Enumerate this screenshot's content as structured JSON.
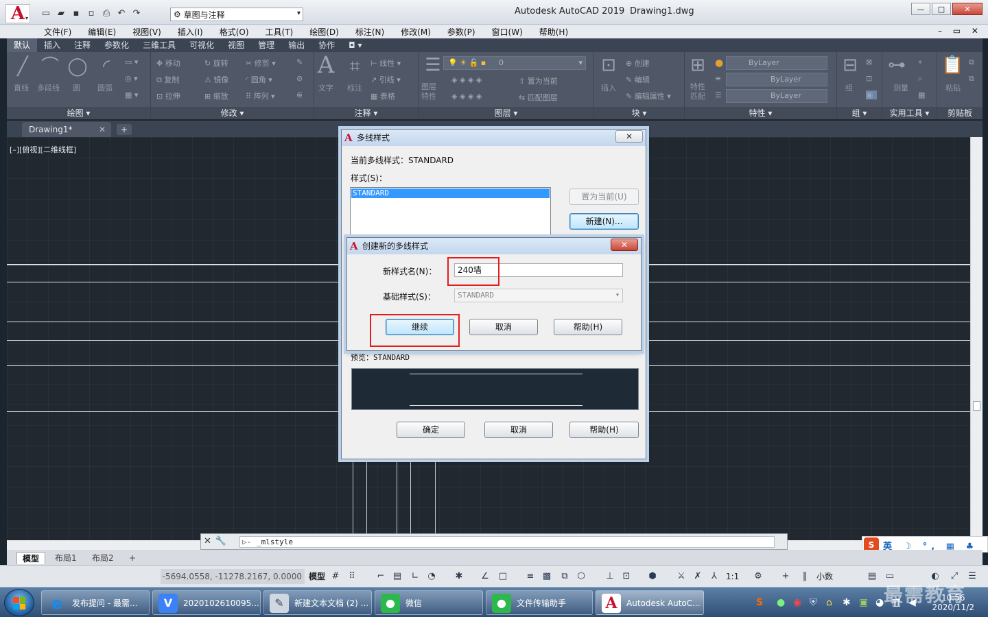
{
  "titlebar": {
    "app_title": "Autodesk AutoCAD 2019",
    "doc_title": "Drawing1.dwg",
    "workspace": "草图与注释",
    "min": "—",
    "max": "□",
    "close": "✕"
  },
  "menubar": {
    "items": [
      "文件(F)",
      "编辑(E)",
      "视图(V)",
      "插入(I)",
      "格式(O)",
      "工具(T)",
      "绘图(D)",
      "标注(N)",
      "修改(M)",
      "参数(P)",
      "窗口(W)",
      "帮助(H)"
    ],
    "mdi_controls": "– ▭ ✕"
  },
  "ribbon": {
    "tabs": [
      "默认",
      "插入",
      "注释",
      "参数化",
      "三维工具",
      "可视化",
      "视图",
      "管理",
      "输出",
      "协作"
    ],
    "tab_extra": "◘ ▾",
    "groups": [
      "绘图 ▾",
      "修改 ▾",
      "注释 ▾",
      "图层 ▾",
      "块 ▾",
      "特性 ▾",
      "组 ▾",
      "实用工具 ▾",
      "剪贴板"
    ],
    "draw_tools": [
      "直线",
      "多段线",
      "圆",
      "圆弧"
    ],
    "modify_tools": [
      "移动",
      "旋转",
      "修剪",
      "复制",
      "镜像",
      "圆角",
      "拉伸",
      "缩放",
      "阵列"
    ],
    "annot_tools": [
      "文字",
      "标注",
      "线性",
      "引线",
      "表格"
    ],
    "layer_tools": [
      "图层特性",
      "置为当前",
      "匹配图层"
    ],
    "layer_current": "0",
    "block_tools": [
      "插入",
      "创建",
      "编辑",
      "编辑属性"
    ],
    "prop_tools": [
      "特性匹配"
    ],
    "prop_values": [
      "ByLayer",
      "ByLayer",
      "ByLayer"
    ],
    "group_tools": [
      "组"
    ],
    "util_tools": [
      "测量"
    ],
    "clip_tools": [
      "粘贴"
    ]
  },
  "doctabs": {
    "active": "Drawing1*",
    "close": "✕",
    "new": "+"
  },
  "canvas": {
    "view_label": "[–][俯视][二维线框]"
  },
  "cmdline": {
    "value": "_mlstyle",
    "prompt": "▷-"
  },
  "layouts": {
    "tabs": [
      "模型",
      "布局1",
      "布局2"
    ],
    "add": "+"
  },
  "statusbar": {
    "coords": "-5694.0558, -11278.2167, 0.0000",
    "model": "模型",
    "scale": "1:1",
    "units": "小数"
  },
  "dialog_mlstyle": {
    "title": "多线样式",
    "current_label": "当前多线样式：STANDARD",
    "styles_label": "样式(S)：",
    "styles": [
      "STANDARD"
    ],
    "set_current": "置为当前(U)",
    "new": "新建(N)...",
    "preview_label": "预览：STANDARD",
    "ok": "确定",
    "cancel": "取消",
    "help": "帮助(H)",
    "close": "✕"
  },
  "dialog_create": {
    "title": "创建新的多线样式",
    "name_label": "新样式名(N)：",
    "name_value": "240墙",
    "base_label": "基础样式(S)：",
    "base_value": "STANDARD",
    "continue": "继续",
    "cancel": "取消",
    "help": "帮助(H)",
    "close": "✕"
  },
  "ime": {
    "logo": "S",
    "text": "英 ☽ °, ▦ ♣ ⇧ 🔧"
  },
  "taskbar": {
    "items": [
      "发布提问 - 最需...",
      "2020102610095...",
      "新建文本文档 (2) ...",
      "微信",
      "文件传输助手",
      "Autodesk AutoC..."
    ],
    "time": "10:56",
    "date": "2020/11/2"
  },
  "watermark": "最需教育",
  "colors": {
    "accent_red": "#e11d1d",
    "autocad_red": "#c8102e",
    "canvas_bg": "#212830",
    "ribbon_bg": "#505867",
    "selection_blue": "#3399ff"
  }
}
